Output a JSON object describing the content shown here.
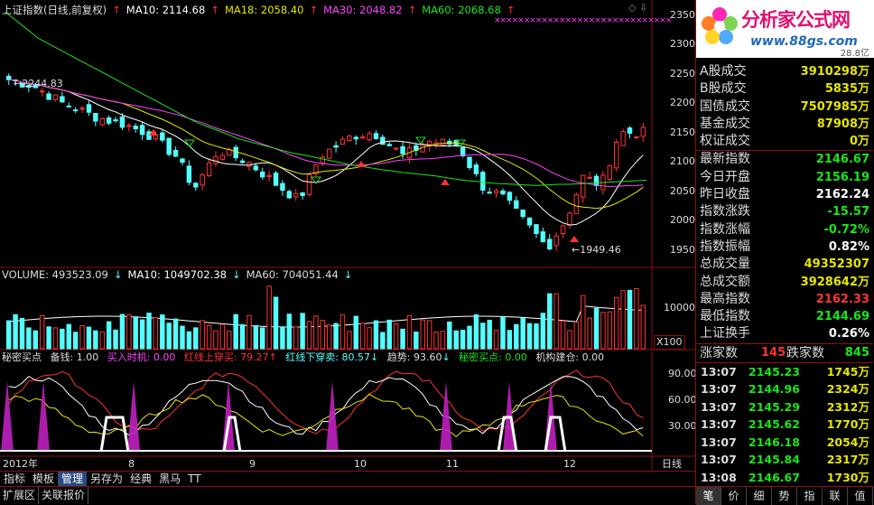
{
  "main_header": {
    "index_title": "上证指数(日线,前复权)",
    "ma10": "MA10: 2114.68",
    "ma18": "MA18: 2058.40",
    "ma30": "MA30: 2048.82",
    "ma60": "MA60: 2068.68"
  },
  "volume_header": {
    "volume": "VOLUME: 493523.09",
    "ma10": "MA10: 1049702.38",
    "ma60": "MA60: 704051.44"
  },
  "indicator_header": {
    "name": "秘密买点",
    "beiqian": "备钱: 1.00",
    "mairu": "买入时机: 0.00",
    "hongshang": "红线上穿买: 79.27",
    "hongxia": "红线下穿卖: 80.57",
    "qushi": "趋势: 93.60",
    "mimi": "秘密买点: 0.00",
    "jigou": "机构建仓: 0.00"
  },
  "price_axis": [
    "2350",
    "2300",
    "2250",
    "2200",
    "2150",
    "2100",
    "2050",
    "2000",
    "1950"
  ],
  "volume_axis": [
    "10000"
  ],
  "volume_unit": "X100",
  "indicator_axis": [
    "90.00",
    "60.00",
    "30.00"
  ],
  "annotations": {
    "high": "2244.83",
    "low": "1949.46"
  },
  "date_axis": {
    "year": "2012年",
    "months": [
      "8",
      "9",
      "10",
      "11",
      "12"
    ],
    "period": "日线"
  },
  "logo": {
    "name": "分析家公式网",
    "url": "www.88gs.com",
    "partial": "28.8亿"
  },
  "stats": [
    {
      "k": "A股成交",
      "v": "3910298万",
      "c": "#e6e600"
    },
    {
      "k": "B股成交",
      "v": "5835万",
      "c": "#e6e600"
    },
    {
      "k": "国债成交",
      "v": "7507985万",
      "c": "#e6e600"
    },
    {
      "k": "基金成交",
      "v": "87908万",
      "c": "#e6e600"
    },
    {
      "k": "权证成交",
      "v": "0万",
      "c": "#e6e600"
    }
  ],
  "stats2": [
    {
      "k": "最新指数",
      "v": "2146.67",
      "c": "#19e619"
    },
    {
      "k": "今日开盘",
      "v": "2156.19",
      "c": "#19e619"
    },
    {
      "k": "昨日收盘",
      "v": "2162.24",
      "c": "#ffffff"
    },
    {
      "k": "指数涨跌",
      "v": "-15.57",
      "c": "#19e619"
    },
    {
      "k": "指数涨幅",
      "v": "-0.72%",
      "c": "#19e619"
    },
    {
      "k": "指数振幅",
      "v": "0.82%",
      "c": "#ffffff"
    },
    {
      "k": "总成交量",
      "v": "49352307",
      "c": "#e6e600"
    },
    {
      "k": "总成交额",
      "v": "3928642万",
      "c": "#e6e600"
    },
    {
      "k": "最高指数",
      "v": "2162.33",
      "c": "#ff3333"
    },
    {
      "k": "最低指数",
      "v": "2144.69",
      "c": "#19e619"
    },
    {
      "k": "上证换手",
      "v": "0.26%",
      "c": "#ffffff"
    }
  ],
  "updown": {
    "up_label": "涨家数",
    "up": "145",
    "down_label": "跌家数",
    "down": "845"
  },
  "ticks": [
    {
      "t": "13:07",
      "p": "2145.23",
      "q": "1745万"
    },
    {
      "t": "13:07",
      "p": "2144.96",
      "q": "2324万"
    },
    {
      "t": "13:07",
      "p": "2145.29",
      "q": "2312万"
    },
    {
      "t": "13:07",
      "p": "2145.62",
      "q": "1770万"
    },
    {
      "t": "13:07",
      "p": "2146.18",
      "q": "2054万"
    },
    {
      "t": "13:07",
      "p": "2145.84",
      "q": "2317万"
    },
    {
      "t": "13:08",
      "p": "2146.67",
      "q": "1730万"
    }
  ],
  "right_tabs": [
    "笔",
    "价",
    "细",
    "势",
    "指",
    "联",
    "值"
  ],
  "tabbar": [
    "指标",
    "模板",
    "管理",
    "另存为",
    "经典",
    "黑马",
    "TT"
  ],
  "bottombar": [
    "扩展区",
    "关联报价"
  ],
  "colors": {
    "up": "#ff3333",
    "down": "#54ffff",
    "ma10": "#ffffff",
    "ma18": "#e6e600",
    "ma30": "#ff40ff",
    "ma60": "#19e619",
    "border": "#8a1010"
  },
  "chart_data": {
    "type": "candlestick",
    "price_ylim": [
      1930,
      2360
    ],
    "annotations": {
      "high": 2244.83,
      "low": 1949.46
    },
    "ma60": [
      2355,
      2340,
      2325,
      2310,
      2300,
      2290,
      2280,
      2270,
      2260,
      2250,
      2240,
      2230,
      2220,
      2210,
      2200,
      2190,
      2180,
      2170,
      2162,
      2155,
      2148,
      2140,
      2135,
      2130,
      2125,
      2120,
      2115,
      2112,
      2108,
      2104,
      2100,
      2096,
      2093,
      2090,
      2087,
      2085,
      2082,
      2080,
      2078,
      2076,
      2073,
      2070,
      2068,
      2066,
      2064,
      2063,
      2062,
      2061,
      2060,
      2061,
      2062,
      2062,
      2063,
      2064,
      2065,
      2066,
      2067,
      2068,
      2069
    ]
  }
}
